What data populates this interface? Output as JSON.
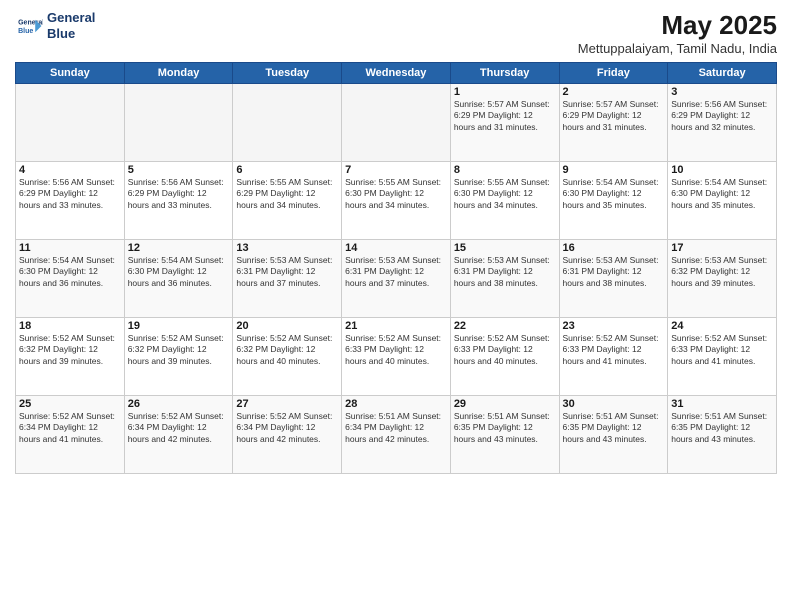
{
  "header": {
    "logo_line1": "General",
    "logo_line2": "Blue",
    "title": "May 2025",
    "subtitle": "Mettuppalaiyam, Tamil Nadu, India"
  },
  "days_of_week": [
    "Sunday",
    "Monday",
    "Tuesday",
    "Wednesday",
    "Thursday",
    "Friday",
    "Saturday"
  ],
  "weeks": [
    [
      {
        "day": "",
        "info": ""
      },
      {
        "day": "",
        "info": ""
      },
      {
        "day": "",
        "info": ""
      },
      {
        "day": "",
        "info": ""
      },
      {
        "day": "1",
        "info": "Sunrise: 5:57 AM\nSunset: 6:29 PM\nDaylight: 12 hours\nand 31 minutes."
      },
      {
        "day": "2",
        "info": "Sunrise: 5:57 AM\nSunset: 6:29 PM\nDaylight: 12 hours\nand 31 minutes."
      },
      {
        "day": "3",
        "info": "Sunrise: 5:56 AM\nSunset: 6:29 PM\nDaylight: 12 hours\nand 32 minutes."
      }
    ],
    [
      {
        "day": "4",
        "info": "Sunrise: 5:56 AM\nSunset: 6:29 PM\nDaylight: 12 hours\nand 33 minutes."
      },
      {
        "day": "5",
        "info": "Sunrise: 5:56 AM\nSunset: 6:29 PM\nDaylight: 12 hours\nand 33 minutes."
      },
      {
        "day": "6",
        "info": "Sunrise: 5:55 AM\nSunset: 6:29 PM\nDaylight: 12 hours\nand 34 minutes."
      },
      {
        "day": "7",
        "info": "Sunrise: 5:55 AM\nSunset: 6:30 PM\nDaylight: 12 hours\nand 34 minutes."
      },
      {
        "day": "8",
        "info": "Sunrise: 5:55 AM\nSunset: 6:30 PM\nDaylight: 12 hours\nand 34 minutes."
      },
      {
        "day": "9",
        "info": "Sunrise: 5:54 AM\nSunset: 6:30 PM\nDaylight: 12 hours\nand 35 minutes."
      },
      {
        "day": "10",
        "info": "Sunrise: 5:54 AM\nSunset: 6:30 PM\nDaylight: 12 hours\nand 35 minutes."
      }
    ],
    [
      {
        "day": "11",
        "info": "Sunrise: 5:54 AM\nSunset: 6:30 PM\nDaylight: 12 hours\nand 36 minutes."
      },
      {
        "day": "12",
        "info": "Sunrise: 5:54 AM\nSunset: 6:30 PM\nDaylight: 12 hours\nand 36 minutes."
      },
      {
        "day": "13",
        "info": "Sunrise: 5:53 AM\nSunset: 6:31 PM\nDaylight: 12 hours\nand 37 minutes."
      },
      {
        "day": "14",
        "info": "Sunrise: 5:53 AM\nSunset: 6:31 PM\nDaylight: 12 hours\nand 37 minutes."
      },
      {
        "day": "15",
        "info": "Sunrise: 5:53 AM\nSunset: 6:31 PM\nDaylight: 12 hours\nand 38 minutes."
      },
      {
        "day": "16",
        "info": "Sunrise: 5:53 AM\nSunset: 6:31 PM\nDaylight: 12 hours\nand 38 minutes."
      },
      {
        "day": "17",
        "info": "Sunrise: 5:53 AM\nSunset: 6:32 PM\nDaylight: 12 hours\nand 39 minutes."
      }
    ],
    [
      {
        "day": "18",
        "info": "Sunrise: 5:52 AM\nSunset: 6:32 PM\nDaylight: 12 hours\nand 39 minutes."
      },
      {
        "day": "19",
        "info": "Sunrise: 5:52 AM\nSunset: 6:32 PM\nDaylight: 12 hours\nand 39 minutes."
      },
      {
        "day": "20",
        "info": "Sunrise: 5:52 AM\nSunset: 6:32 PM\nDaylight: 12 hours\nand 40 minutes."
      },
      {
        "day": "21",
        "info": "Sunrise: 5:52 AM\nSunset: 6:33 PM\nDaylight: 12 hours\nand 40 minutes."
      },
      {
        "day": "22",
        "info": "Sunrise: 5:52 AM\nSunset: 6:33 PM\nDaylight: 12 hours\nand 40 minutes."
      },
      {
        "day": "23",
        "info": "Sunrise: 5:52 AM\nSunset: 6:33 PM\nDaylight: 12 hours\nand 41 minutes."
      },
      {
        "day": "24",
        "info": "Sunrise: 5:52 AM\nSunset: 6:33 PM\nDaylight: 12 hours\nand 41 minutes."
      }
    ],
    [
      {
        "day": "25",
        "info": "Sunrise: 5:52 AM\nSunset: 6:34 PM\nDaylight: 12 hours\nand 41 minutes."
      },
      {
        "day": "26",
        "info": "Sunrise: 5:52 AM\nSunset: 6:34 PM\nDaylight: 12 hours\nand 42 minutes."
      },
      {
        "day": "27",
        "info": "Sunrise: 5:52 AM\nSunset: 6:34 PM\nDaylight: 12 hours\nand 42 minutes."
      },
      {
        "day": "28",
        "info": "Sunrise: 5:51 AM\nSunset: 6:34 PM\nDaylight: 12 hours\nand 42 minutes."
      },
      {
        "day": "29",
        "info": "Sunrise: 5:51 AM\nSunset: 6:35 PM\nDaylight: 12 hours\nand 43 minutes."
      },
      {
        "day": "30",
        "info": "Sunrise: 5:51 AM\nSunset: 6:35 PM\nDaylight: 12 hours\nand 43 minutes."
      },
      {
        "day": "31",
        "info": "Sunrise: 5:51 AM\nSunset: 6:35 PM\nDaylight: 12 hours\nand 43 minutes."
      }
    ]
  ]
}
